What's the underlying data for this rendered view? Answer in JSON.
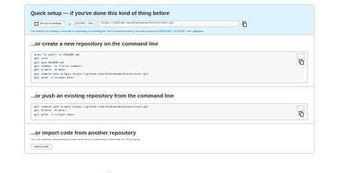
{
  "quick_setup": {
    "title": "Quick setup — if you've done this kind of thing before",
    "desktop_button": "Set up in Desktop",
    "or": "or",
    "https_tab": "HTTPS",
    "ssh_tab": "SSH",
    "url": "https://github.com/AleksandarDickov/text.git",
    "help_prefix": "Get started by ",
    "help_link1": "creating a new file",
    "help_mid": " or ",
    "help_link2": "uploading an existing file",
    "help_mid2": ". We recommend every repository include a ",
    "help_link3": "README",
    "help_sep1": ", ",
    "help_link4": "LICENSE",
    "help_sep2": ", and ",
    "help_link5": ".gitignore",
    "help_end": ".",
    "icon": "copy-icon"
  },
  "create_repo": {
    "title": "...or create a new repository on the command line",
    "code": "echo \"# text\" >> README.md\ngit init\ngit add README.md\ngit commit -m \"first commit\"\ngit branch -M main\ngit remote add origin https://github.com/AleksandarDickov/text.git\ngit push -u origin main"
  },
  "push_repo": {
    "title": "...or push an existing repository from the command line",
    "code": "git remote add origin https://github.com/AleksandarDickov/text.git\ngit branch -M main\ngit push -u origin main"
  },
  "import_repo": {
    "title": "...or import code from another repository",
    "description": "You can initialize this repository with code from a Subversion, Mercurial, or TFS project.",
    "button": "Import code"
  },
  "footer": {
    "hint": "• • •"
  }
}
